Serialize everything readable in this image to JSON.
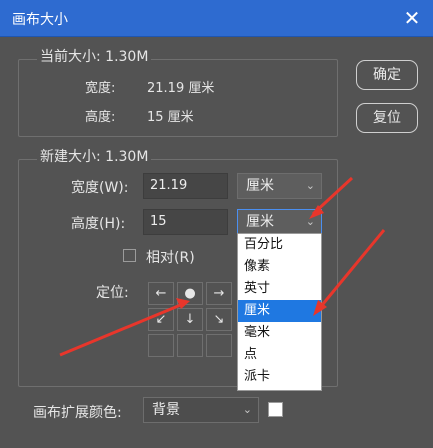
{
  "window": {
    "title": "画布大小",
    "close_glyph": "✕"
  },
  "current_size": {
    "label": "当前大小: 1.30M",
    "width_label": "宽度:",
    "width_value": "21.19 厘米",
    "height_label": "高度:",
    "height_value": "15 厘米"
  },
  "buttons": {
    "ok": "确定",
    "reset": "复位"
  },
  "new_size": {
    "label": "新建大小: 1.30M",
    "width_label": "宽度(W):",
    "width_value": "21.19",
    "width_unit": "厘米",
    "height_label": "高度(H):",
    "height_value": "15",
    "height_unit": "厘米",
    "relative_label": "相对(R)",
    "relative_checked": false,
    "anchor_label": "定位:"
  },
  "unit_options": [
    "百分比",
    "像素",
    "英寸",
    "厘米",
    "毫米",
    "点",
    "派卡"
  ],
  "selected_unit": "厘米",
  "anchor_glyphs": {
    "left": "←",
    "center": "●",
    "right": "→",
    "down_left": "↙",
    "down": "↓",
    "down_right": "↘"
  },
  "extension": {
    "label": "画布扩展颜色:",
    "value": "背景",
    "swatch_color": "#ffffff"
  },
  "chevron": "⌄",
  "colors": {
    "title_bar": "#2e6bd0",
    "panel": "#535353",
    "highlight": "#1f78e1",
    "annotation": "#e8362b"
  }
}
